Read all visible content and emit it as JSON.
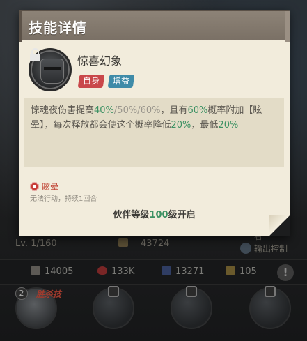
{
  "background": {
    "level": "Lv. 1/160",
    "power": "43724",
    "role_partial": "者",
    "role_label": "输出控制",
    "stats": {
      "attack": "14005",
      "hp": "133K",
      "defense": "13271",
      "speed": "105",
      "alert": "!"
    },
    "slot_number": "2",
    "slot_tag": "胜杀技"
  },
  "card": {
    "title": "技能详情",
    "skill_name": "惊喜幻象",
    "tags": [
      "自身",
      "增益"
    ],
    "description": {
      "p1": "惊魂夜伤害提高",
      "v1": "40%",
      "v2": "/50%/60%",
      "p2": "，且有",
      "v3": "60%",
      "p3": "概率附加【眩晕】，每次释放都会使这个概率降低",
      "v4": "20%",
      "p4": "，最低",
      "v5": "20%"
    },
    "status": {
      "name": "眩晕",
      "desc": "无法行动，持续1回合"
    },
    "unlock": {
      "prefix": "伙伴等级",
      "level": "100",
      "suffix": "级开启"
    }
  },
  "colors": {
    "highlight_green": "#3c9163",
    "tag_self": "#c9474a",
    "tag_buff": "#3f8ba8",
    "status_red": "#c24a3a"
  },
  "icons": [
    "lock-icon",
    "stun-status-icon",
    "attack-icon",
    "hp-heart-icon",
    "defense-shield-icon",
    "speed-icon"
  ]
}
